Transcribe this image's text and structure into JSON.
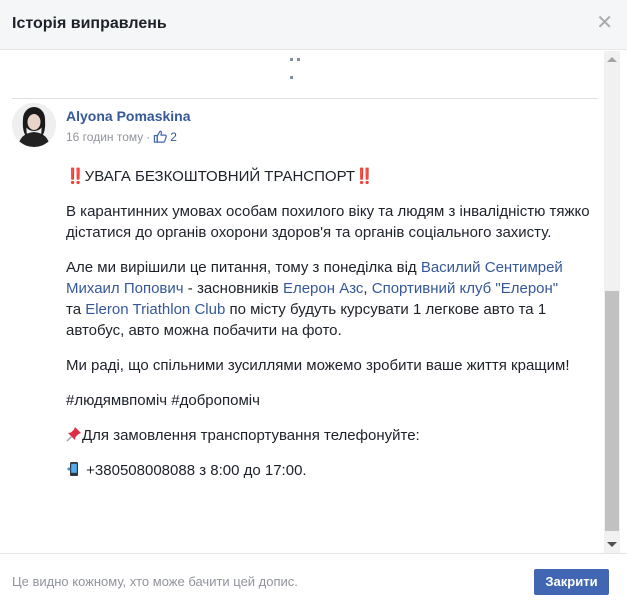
{
  "dialog": {
    "title": "Історія виправлень",
    "close_icon": "close-icon"
  },
  "post": {
    "author": "Alyona Pomaskina",
    "time": "16 годин тому",
    "likes": "2",
    "headline": "‼️УВАГА БЕЗКОШТОВНИЙ ТРАНСПОРТ‼️",
    "para1": "В карантинних умовах особам похилого віку та людям з інвалідністю тяжко дістатися до органів охорони здоров'я та органів соціального захисту.",
    "para2_a": "Але ми вирішили це питання, тому з понеділка від ",
    "para2_link1": "Василий Сентимрей",
    "para2_link2": "Михаил Попович",
    "para2_b": " - засновників ",
    "para2_link3": "Елерон Азс",
    "para2_c": ", ",
    "para2_link4": "Спортивний клуб \"Елерон\"",
    "para2_d": " та ",
    "para2_link5": "Eleron Triathlon Club",
    "para2_e": " по місту будуть курсувати 1 легкове авто та 1 автобус, авто можна побачити на фото.",
    "para3": "Ми раді, що спільними зусиллями можемо зробити ваше життя кращим!",
    "hashtags": "#людямвпоміч #добропоміч",
    "order_text": "Для замовлення транспортування телефонуйте:",
    "phone_text": "+380508008088 з 8:00 до 17:00."
  },
  "footer": {
    "note": "Це видно кожному, хто може бачити цей допис.",
    "close_label": "Закрити"
  },
  "colors": {
    "accent": "#4267b2",
    "link": "#365899",
    "muted": "#90949c"
  }
}
